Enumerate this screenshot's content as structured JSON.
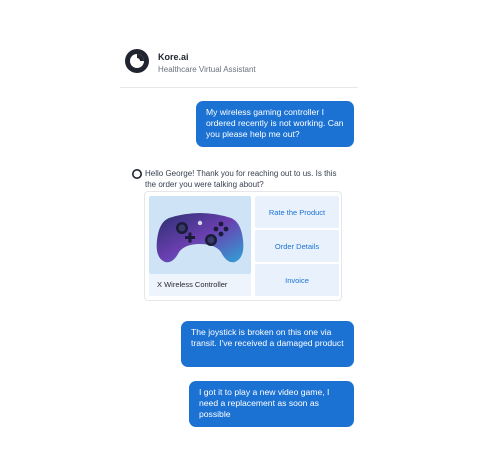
{
  "header": {
    "brand": "Kore.ai",
    "subtitle": "Healthcare Virtual Assistant",
    "logo_icon": "kore-logo-icon"
  },
  "messages": {
    "user1": "My wireless gaming controller I ordered recently is not working. Can you please help me out?",
    "bot1": "Hello George! Thank you for reaching out to us. Is this the order you were talking about?",
    "user2": "The joystick is broken on this one via transit. I've received a damaged product",
    "user3": "I got it to play a new video game, I need a replacement as soon as possible"
  },
  "card": {
    "product_name": "X Wireless Controller",
    "actions": [
      "Rate the Product",
      "Order Details",
      "Invoice"
    ]
  },
  "colors": {
    "accent": "#1c72d3",
    "action_bg": "#e8f1fc",
    "product_bg": "#cfe3f6"
  }
}
